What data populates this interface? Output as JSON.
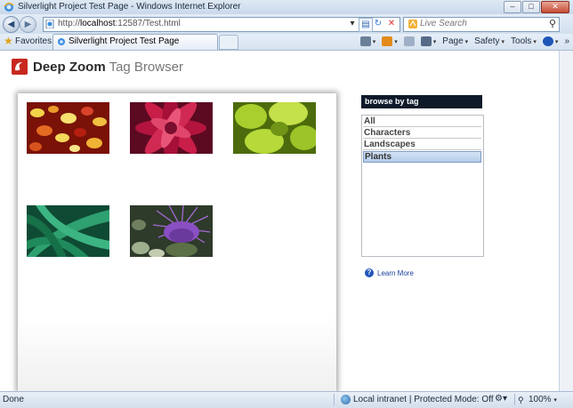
{
  "window": {
    "title": "Silverlight Project Test Page - Windows Internet Explorer",
    "controls": {
      "minimize": "–",
      "maximize": "□",
      "close": "✕"
    }
  },
  "nav": {
    "back_icon": "◀",
    "forward_icon": "▶",
    "url_prefix": "http://",
    "url_host": "localhost",
    "url_rest": ":12587/Test.html",
    "refresh_icon": "↻",
    "stop_icon": "✕",
    "search_placeholder": "Live Search",
    "search_icon": "⚲"
  },
  "favbar": {
    "favorites_label": "Favorites",
    "tab_label": "Silverlight Project Test Page",
    "commands": [
      {
        "label": "",
        "icon": "home-icon",
        "color": "#6b7f99"
      },
      {
        "label": "",
        "icon": "feeds-icon",
        "color": "#e38b1b"
      },
      {
        "label": "",
        "icon": "mail-icon",
        "color": "#7d8fa8"
      },
      {
        "label": "",
        "icon": "print-icon",
        "color": "#556b88"
      },
      {
        "label": "Page",
        "icon": "",
        "color": ""
      },
      {
        "label": "Safety",
        "icon": "",
        "color": ""
      },
      {
        "label": "Tools",
        "icon": "",
        "color": ""
      },
      {
        "label": "",
        "icon": "help-icon",
        "color": "#1f55b8"
      }
    ],
    "chevron": "»"
  },
  "app": {
    "title_bold": "Deep Zoom",
    "title_light": " Tag Browser",
    "tag_header": "browse by tag",
    "tags": [
      {
        "label": "All",
        "selected": false
      },
      {
        "label": "Characters",
        "selected": false
      },
      {
        "label": "Landscapes",
        "selected": false
      },
      {
        "label": "Plants",
        "selected": true
      }
    ],
    "learn_more": "Learn More",
    "learn_icon": "?",
    "thumbnails": [
      {
        "name": "autumn-leaves"
      },
      {
        "name": "red-dahlia"
      },
      {
        "name": "green-succulent"
      },
      {
        "name": "green-agave"
      },
      {
        "name": "purple-artichoke"
      }
    ]
  },
  "status": {
    "text": "Done",
    "zone": "Local intranet | Protected Mode: Off",
    "zoom": "100%"
  }
}
